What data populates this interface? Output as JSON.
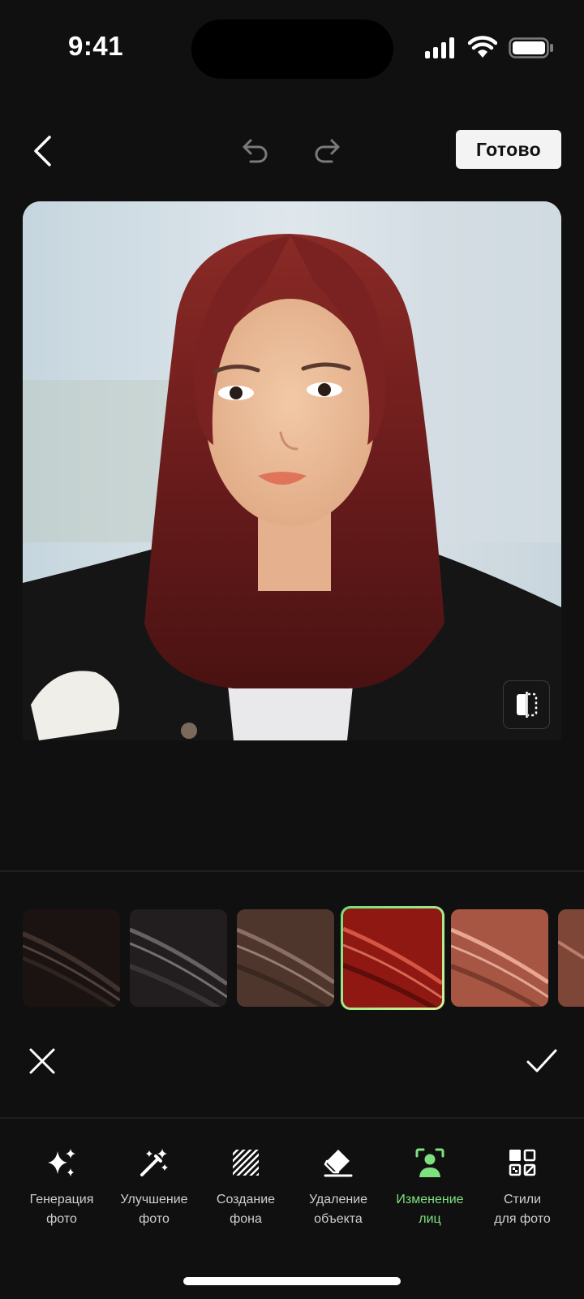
{
  "status_bar": {
    "time": "9:41"
  },
  "toolbar": {
    "done_label": "Готово"
  },
  "swatches": [
    {
      "name": "dark-brown-swatch",
      "color": "#1c1512"
    },
    {
      "name": "ash-black-swatch",
      "color": "#2a2628"
    },
    {
      "name": "chocolate-brown-swatch",
      "color": "#5a4036"
    },
    {
      "name": "cherry-red-swatch",
      "color": "#9e1f1a",
      "selected": true
    },
    {
      "name": "copper-swatch",
      "color": "#b8644f"
    },
    {
      "name": "auburn-swatch",
      "color": "#8a5040"
    }
  ],
  "tools": [
    {
      "label": "Генерация\nфото",
      "icon": "sparkles-icon",
      "active": false
    },
    {
      "label": "Улучшение\nфото",
      "icon": "magic-wand-icon",
      "active": false
    },
    {
      "label": "Создание\nфона",
      "icon": "background-stripes-icon",
      "active": false
    },
    {
      "label": "Удаление\nобъекта",
      "icon": "eraser-icon",
      "active": false
    },
    {
      "label": "Изменение\nлиц",
      "icon": "face-scan-icon",
      "active": true
    },
    {
      "label": "Стили\nдля фото",
      "icon": "styles-grid-icon",
      "active": false
    }
  ],
  "colors": {
    "accent": "#7fe07f",
    "background": "#101010"
  }
}
